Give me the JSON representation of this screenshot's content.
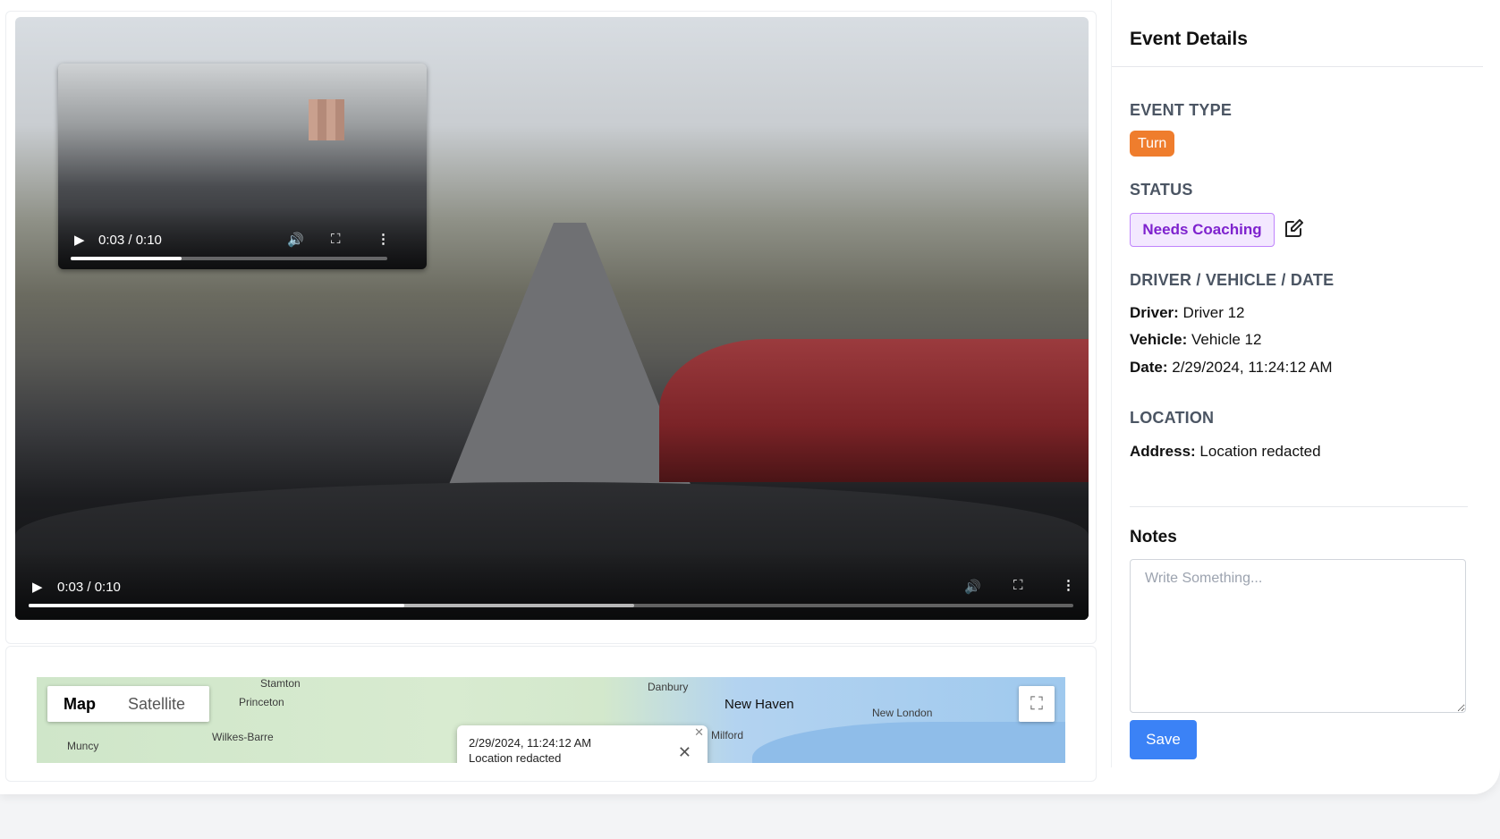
{
  "main_video": {
    "current_time": "0:03",
    "duration": "0:10",
    "time_label": "0:03 / 0:10",
    "progress": 0.36,
    "buffered": 0.58
  },
  "pip_video": {
    "time_label": "0:03 / 0:10",
    "progress": 0.35
  },
  "map": {
    "tab_map": "Map",
    "tab_satellite": "Satellite",
    "active_tab": "Map",
    "places": [
      "Stamton",
      "Princeton",
      "Muncy",
      "Wilkes-Barre",
      "Danbury",
      "New Haven",
      "Milford",
      "New London"
    ],
    "popup": {
      "date": "2/29/2024, 11:24:12 AM",
      "address": "Location redacted"
    }
  },
  "panel": {
    "title": "Event Details",
    "event_type_label": "EVENT TYPE",
    "event_type": "Turn",
    "status_label": "STATUS",
    "status": "Needs Coaching",
    "dvd_label": "DRIVER / VEHICLE / DATE",
    "driver_key": "Driver:",
    "driver": "Driver 12",
    "vehicle_key": "Vehicle:",
    "vehicle": "Vehicle 12",
    "date_key": "Date:",
    "date": "2/29/2024, 11:24:12 AM",
    "location_label": "LOCATION",
    "address_key": "Address:",
    "address": "Location redacted",
    "notes_title": "Notes",
    "notes_placeholder": "Write Something...",
    "save_label": "Save"
  },
  "colors": {
    "turn_badge": "#ef7d2d",
    "status_badge_bg": "#f3e8ff",
    "status_badge_text": "#7e22ce",
    "save_button": "#3b82f6"
  }
}
